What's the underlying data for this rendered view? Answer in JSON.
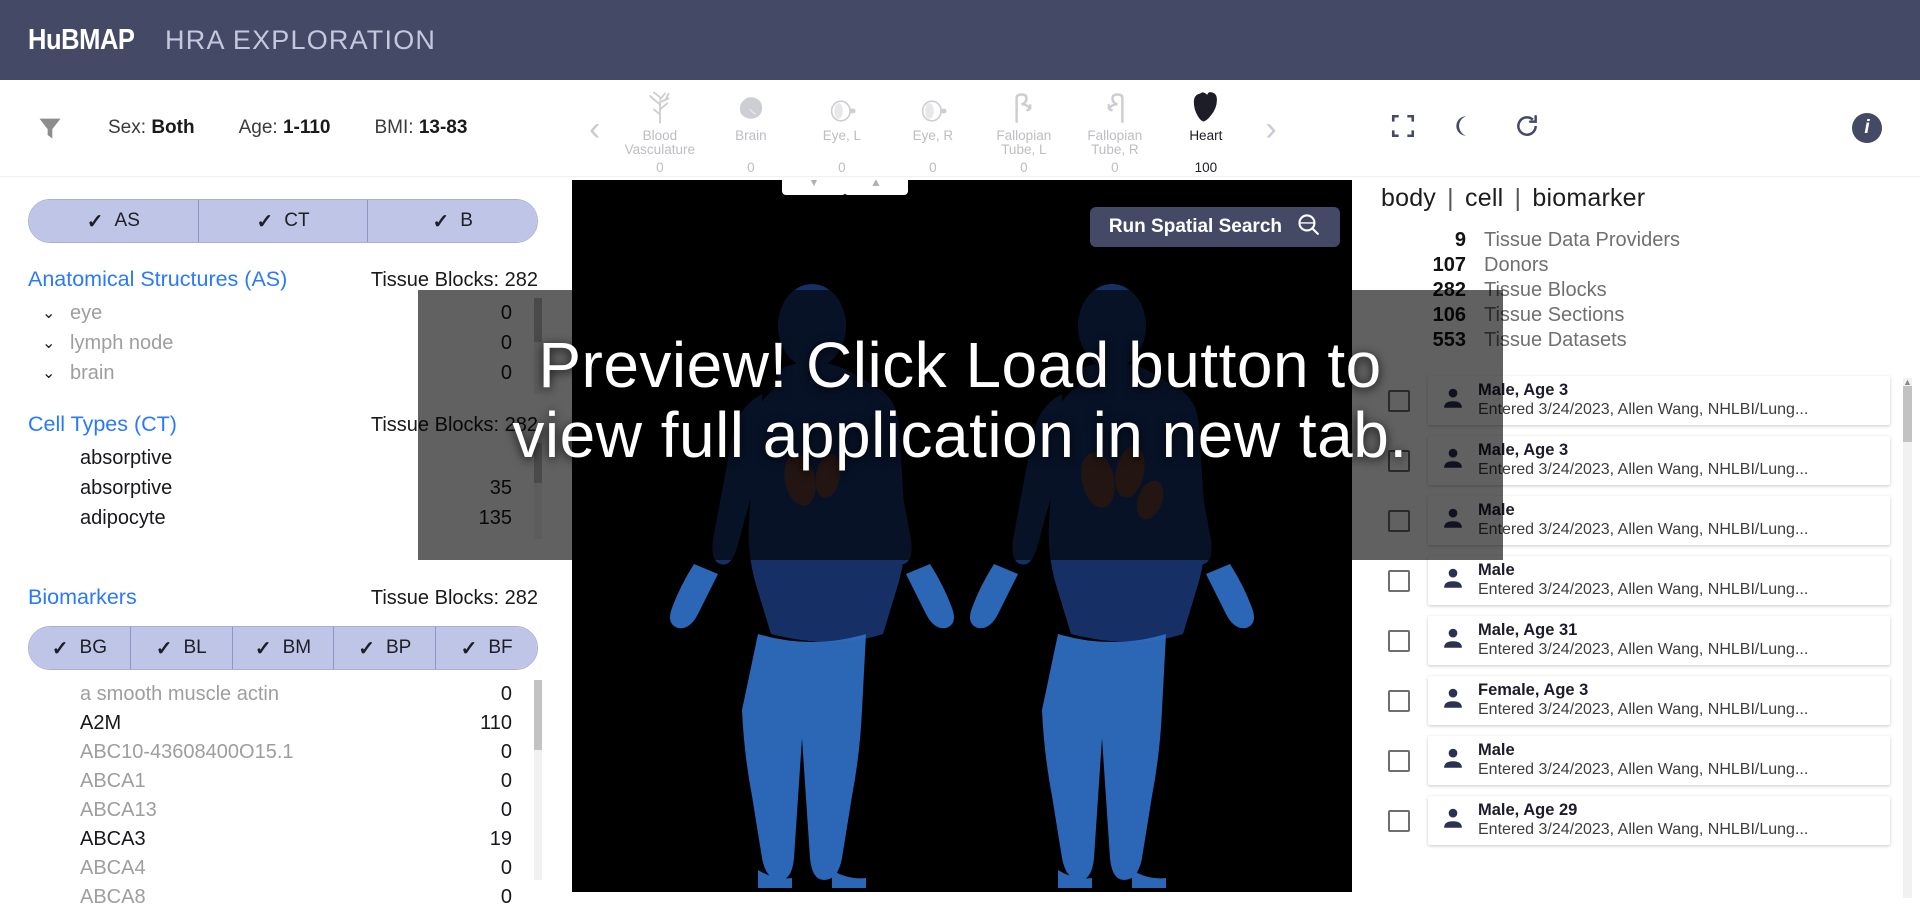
{
  "header": {
    "brand": "HuBMAP",
    "title": "HRA EXPLORATION"
  },
  "filters": {
    "funnel_icon": "filter-funnel-icon",
    "sex": {
      "label": "Sex:",
      "value": "Both"
    },
    "age": {
      "label": "Age:",
      "value": "1-110"
    },
    "bmi": {
      "label": "BMI:",
      "value": "13-83"
    }
  },
  "organ_nav": {
    "prev_label": "‹",
    "next_label": "›",
    "organs": [
      {
        "name": "Blood Vasculature",
        "count": "0",
        "icon": "blood-vasculature-icon",
        "active": false
      },
      {
        "name": "Brain",
        "count": "0",
        "icon": "brain-icon",
        "active": false
      },
      {
        "name": "Eye, L",
        "count": "0",
        "icon": "eye-left-icon",
        "active": false
      },
      {
        "name": "Eye, R",
        "count": "0",
        "icon": "eye-right-icon",
        "active": false
      },
      {
        "name": "Fallopian Tube, L",
        "count": "0",
        "icon": "fallopian-tube-left-icon",
        "active": false
      },
      {
        "name": "Fallopian Tube, R",
        "count": "0",
        "icon": "fallopian-tube-right-icon",
        "active": false
      },
      {
        "name": "Heart",
        "count": "100",
        "icon": "heart-icon",
        "active": true
      }
    ]
  },
  "tools": {
    "fullscreen": "fullscreen-icon",
    "darkmode": "dark-mode-moon-icon",
    "reset": "reset-refresh-icon",
    "info": "i"
  },
  "left_panel": {
    "toggles": [
      {
        "label": "AS",
        "checked": true
      },
      {
        "label": "CT",
        "checked": true
      },
      {
        "label": "B",
        "checked": true
      }
    ],
    "anatomical_structures": {
      "title": "Anatomical Structures (AS)",
      "count_label": "Tissue Blocks: 282",
      "rows": [
        {
          "label": "brain",
          "value": "0",
          "expandable": true
        },
        {
          "label": "lymph node",
          "value": "0",
          "expandable": true
        },
        {
          "label": "eye",
          "value": "0",
          "expandable": true
        }
      ]
    },
    "cell_types": {
      "title": "Cell Types (CT)",
      "count_label": "Tissue Blocks: 282",
      "rows": [
        {
          "label": "absorptive",
          "value": "",
          "dark": true
        },
        {
          "label": "absorptive",
          "value": "35",
          "dark": true
        },
        {
          "label": "adipocyte",
          "value": "135",
          "dark": true
        }
      ]
    },
    "biomarkers": {
      "title": "Biomarkers",
      "count_label": "Tissue Blocks: 282",
      "toggles": [
        {
          "label": "BG",
          "checked": true
        },
        {
          "label": "BL",
          "checked": true
        },
        {
          "label": "BM",
          "checked": true
        },
        {
          "label": "BP",
          "checked": true
        },
        {
          "label": "BF",
          "checked": true
        }
      ],
      "rows": [
        {
          "label": "a smooth muscle actin",
          "value": "0",
          "dark": false
        },
        {
          "label": "A2M",
          "value": "110",
          "dark": true
        },
        {
          "label": "ABC10-43608400O15.1",
          "value": "0",
          "dark": false
        },
        {
          "label": "ABCA1",
          "value": "0",
          "dark": false
        },
        {
          "label": "ABCA13",
          "value": "0",
          "dark": false
        },
        {
          "label": "ABCA3",
          "value": "19",
          "dark": true
        },
        {
          "label": "ABCA4",
          "value": "0",
          "dark": false
        },
        {
          "label": "ABCA8",
          "value": "0",
          "dark": false
        }
      ]
    }
  },
  "stage": {
    "spatial_search_label": "Run Spatial Search",
    "spatial_search_icon": "spatial-search-icon",
    "nav_down_icon": "caret-down-icon",
    "nav_up_icon": "caret-up-icon",
    "left_arrow": "‹",
    "right_arrow": "›"
  },
  "overlay": {
    "line1": "Preview! Click Load button to",
    "line2": "view full application in new tab."
  },
  "right_panel": {
    "breadcrumb": {
      "body": "body",
      "cell": "cell",
      "biomarker": "biomarker",
      "separator": "|"
    },
    "stats": [
      {
        "value": "9",
        "label": "Tissue Data Providers"
      },
      {
        "value": "107",
        "label": "Donors"
      },
      {
        "value": "282",
        "label": "Tissue Blocks"
      },
      {
        "value": "106",
        "label": "Tissue Sections"
      },
      {
        "value": "553",
        "label": "Tissue Datasets"
      }
    ],
    "donors": [
      {
        "title": "Male, Age 3",
        "subtitle": "Entered 3/24/2023, Allen Wang, NHLBI/Lung...",
        "checked": false
      },
      {
        "title": "Male, Age 3",
        "subtitle": "Entered 3/24/2023, Allen Wang, NHLBI/Lung...",
        "checked": false
      },
      {
        "title": "Male",
        "subtitle": "Entered 3/24/2023, Allen Wang, NHLBI/Lung...",
        "checked": false
      },
      {
        "title": "Male",
        "subtitle": "Entered 3/24/2023, Allen Wang, NHLBI/Lung...",
        "checked": false
      },
      {
        "title": "Male, Age 31",
        "subtitle": "Entered 3/24/2023, Allen Wang, NHLBI/Lung...",
        "checked": false
      },
      {
        "title": "Female, Age 3",
        "subtitle": "Entered 3/24/2023, Allen Wang, NHLBI/Lung...",
        "checked": false
      },
      {
        "title": "Male",
        "subtitle": "Entered 3/24/2023, Allen Wang, NHLBI/Lung...",
        "checked": false
      },
      {
        "title": "Male, Age 29",
        "subtitle": "Entered 3/24/2023, Allen Wang, NHLBI/Lung...",
        "checked": false
      }
    ]
  },
  "colors": {
    "header_bg": "#444a65",
    "accent_blue": "#2979ff",
    "toggle_bg": "#bfc5e6",
    "stage_bg": "#000000",
    "body_blue": "#2f6fc4"
  }
}
